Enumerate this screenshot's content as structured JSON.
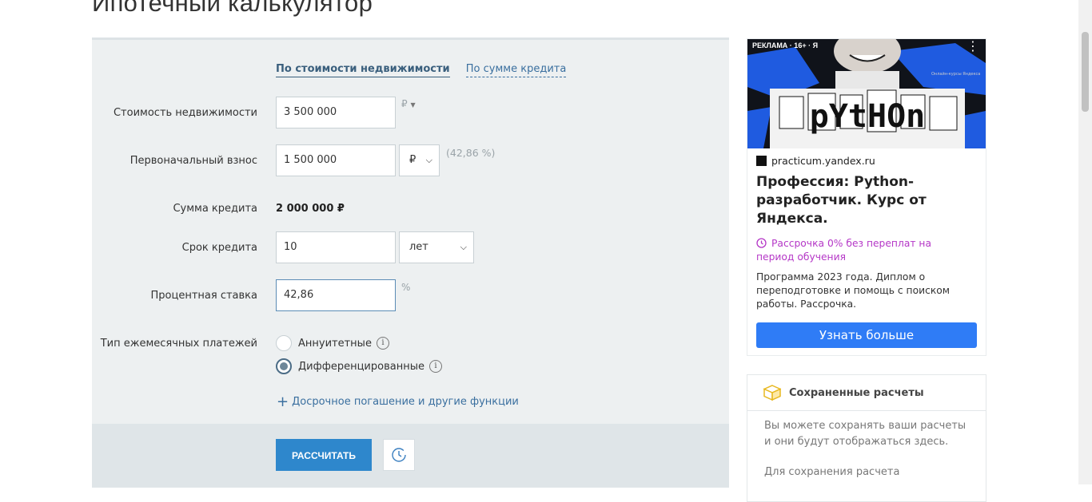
{
  "page": {
    "title": "Ипотечный калькулятор"
  },
  "calculator": {
    "tabs": [
      {
        "label": "По стоимости недвижимости",
        "active": true
      },
      {
        "label": "По сумме кредита",
        "active": false
      }
    ],
    "property_cost": {
      "label": "Стоимость недвижимости",
      "value": "3 500 000",
      "currency": "₽"
    },
    "down_payment": {
      "label": "Первоначальный взнос",
      "value": "1 500 000",
      "unit_selected": "₽",
      "percent_text": "(42,86 %)"
    },
    "loan_amount": {
      "label": "Сумма кредита",
      "value": "2 000 000 ₽"
    },
    "term": {
      "label": "Срок кредита",
      "value": "10",
      "unit_selected": "лет"
    },
    "rate": {
      "label": "Процентная ставка",
      "value": "42,86",
      "unit": "%"
    },
    "payment_type": {
      "label": "Тип ежемесячных платежей",
      "options": [
        {
          "label": "Аннуитетные",
          "checked": false
        },
        {
          "label": "Дифференцированные",
          "checked": true
        }
      ]
    },
    "more_link": "Досрочное погашение и другие функции",
    "calculate_button": "РАССЧИТАТЬ"
  },
  "ad": {
    "badge": "РЕКЛАМА · 16+ · Я",
    "image_word": "pYtHOn",
    "image_small_text": "Онлайн-курсы Яндекса",
    "domain": "practicum.yandex.ru",
    "title": "Профессия: Python-разработчик. Курс от Яндекса.",
    "installment": "Рассрочка 0% без переплат на период обучения",
    "description": "Программа 2023 года. Диплом о переподготовке и помощь с поиском работы. Рассрочка.",
    "button": "Узнать больше",
    "colors": {
      "accent": "#2f7cf6",
      "installment": "#b537c7",
      "image_blue": "#1f5be0"
    }
  },
  "saved": {
    "title": "Сохраненные расчеты",
    "text": "Вы можете сохранять ваши расчеты и они будут отображаться здесь.",
    "text2": "Для сохранения расчета"
  }
}
